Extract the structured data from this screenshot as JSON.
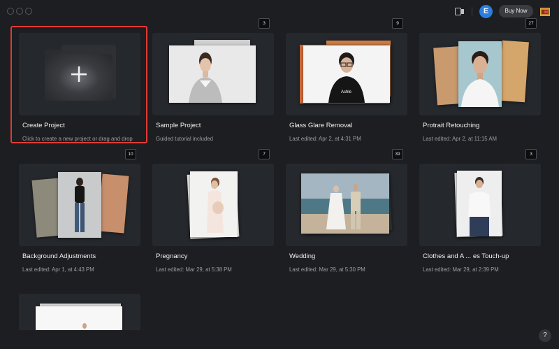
{
  "header": {
    "avatar_letter": "E",
    "buy_label": "Buy Now",
    "icons": [
      "window-close-dot",
      "window-minimize-dot",
      "window-zoom-dot",
      "share-icon",
      "gallery-icon"
    ]
  },
  "create": {
    "title": "Create Project",
    "subtitle": "Click to create a new project or drag and drop"
  },
  "projects": [
    {
      "title": "Sample Project",
      "subtitle": "Guided tutorial included",
      "count": "3"
    },
    {
      "title": "Glass Glare Removal",
      "subtitle": "Last edited: Apr 2, at 4:31 PM",
      "count": "9"
    },
    {
      "title": "Protrait Retouching",
      "subtitle": "Last edited: Apr 2, at 11:15 AM",
      "count": "27"
    },
    {
      "title": "Background Adjustments",
      "subtitle": "Last edited: Apr 1, at 4:43 PM",
      "count": "10"
    },
    {
      "title": "Pregnancy",
      "subtitle": "Last edited: Mar 29, at 5:38 PM",
      "count": "7"
    },
    {
      "title": "Wedding",
      "subtitle": "Last edited: Mar 29, at 5:30 PM",
      "count": "39"
    },
    {
      "title": "Clothes and A ... es Touch-up",
      "subtitle": "Last edited: Mar 29, at 2:39 PM",
      "count": "3"
    }
  ],
  "help_label": "?",
  "colors": {
    "background": "#1c1e21",
    "card": "#25282c",
    "accent_selection": "#e23a35",
    "avatar": "#2a7de1"
  }
}
